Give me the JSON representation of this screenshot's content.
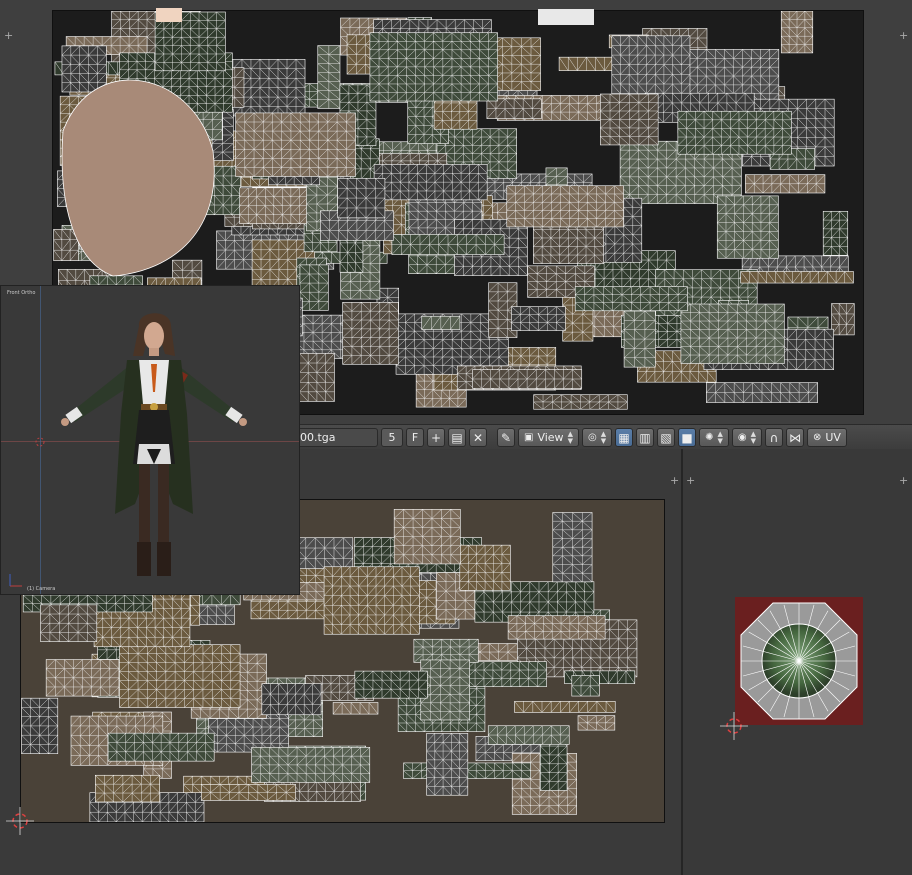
{
  "header": {
    "image_name": "00.tga",
    "users_count": "5",
    "fake_user_label": "F",
    "view_menu_label": "View",
    "uv_menu_label": "UV"
  },
  "viewport3d": {
    "view_label": "Front Ortho",
    "object_label": "(1) Camera"
  },
  "colors": {
    "background": "#3d3d3d",
    "header": "#484848",
    "uv_wire": "#ffffff",
    "selected_button": "#5a7ea8",
    "small_texture": "#6a1f1f"
  },
  "icons": [
    "add-icon",
    "open-folder-icon",
    "close-icon",
    "pin-icon",
    "view-icon",
    "pivot-icon",
    "uv-sync-icon",
    "vertex-select-icon",
    "edge-select-icon",
    "face-select-icon",
    "island-select-icon",
    "sticky-select-icon",
    "proportional-edit-icon",
    "snap-icon",
    "uv-layer-icon"
  ]
}
